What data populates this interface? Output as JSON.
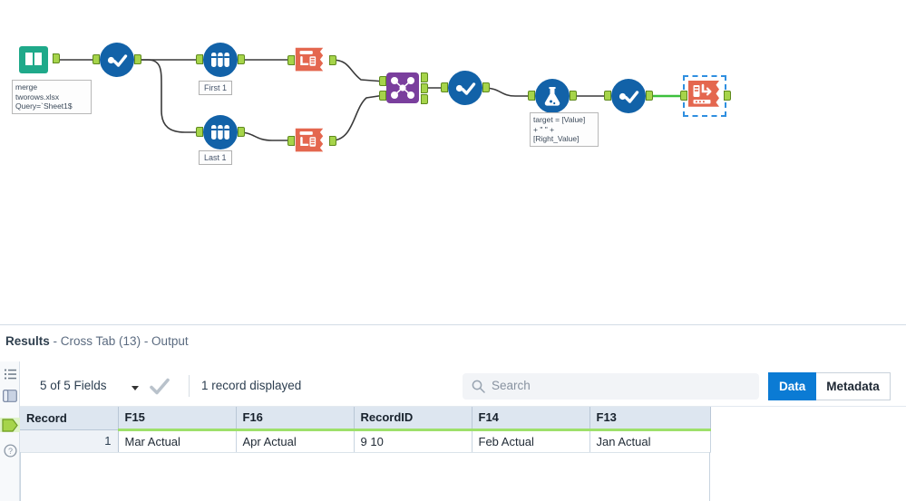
{
  "workflow": {
    "nodes": [
      {
        "id": "input-data",
        "icon": "book-icon",
        "tool": "Input Data"
      },
      {
        "id": "select-1",
        "icon": "check-icon",
        "tool": "Select"
      },
      {
        "id": "sample-first",
        "icon": "sample-icon",
        "tool": "Sample",
        "label": "First 1"
      },
      {
        "id": "sample-last",
        "icon": "sample-icon",
        "tool": "Sample",
        "label": "Last 1"
      },
      {
        "id": "transpose-1",
        "icon": "transpose-icon",
        "tool": "Transpose"
      },
      {
        "id": "transpose-2",
        "icon": "transpose-icon",
        "tool": "Transpose"
      },
      {
        "id": "join",
        "icon": "join-icon",
        "tool": "Join"
      },
      {
        "id": "select-2",
        "icon": "check-icon",
        "tool": "Select"
      },
      {
        "id": "formula",
        "icon": "flask-icon",
        "tool": "Formula"
      },
      {
        "id": "select-3",
        "icon": "check-icon",
        "tool": "Select"
      },
      {
        "id": "crosstab",
        "icon": "crosstab-icon",
        "tool": "Cross Tab",
        "selected": true
      }
    ],
    "annotations": {
      "input": "merge\ntworows.xlsx\nQuery=`Sheet1$",
      "formula": "target = [Value]\n+ \" \" +\n[Right_Value]"
    },
    "labels": {
      "first": "First 1",
      "last": "Last 1"
    },
    "colors": {
      "input_tool": "#1fa98a",
      "blue_tool": "#1262a8",
      "transpose_tool": "#e4674f",
      "join_tool": "#7a3f9d",
      "anchor": "#a6d44a",
      "selection": "#2f8fe0",
      "connection_active": "#3cc03c"
    }
  },
  "results": {
    "title_bold": "Results",
    "title_rest": " - Cross Tab (13) - Output",
    "rail": [
      {
        "name": "list-icon"
      },
      {
        "name": "panel-icon"
      },
      {
        "name": "output-anchor-icon"
      },
      {
        "name": "help-icon"
      }
    ],
    "toolbar": {
      "fields_label": "5 of 5 Fields",
      "records_label": "1 record displayed",
      "search_placeholder": "Search",
      "data_tab": "Data",
      "metadata_tab": "Metadata",
      "active_tab": "Data"
    },
    "table": {
      "columns": [
        "Record",
        "F15",
        "F16",
        "RecordID",
        "F14",
        "F13"
      ],
      "rows": [
        [
          "1",
          "Mar Actual",
          "Apr Actual",
          "9 10",
          "Feb Actual",
          "Jan Actual"
        ]
      ]
    }
  }
}
